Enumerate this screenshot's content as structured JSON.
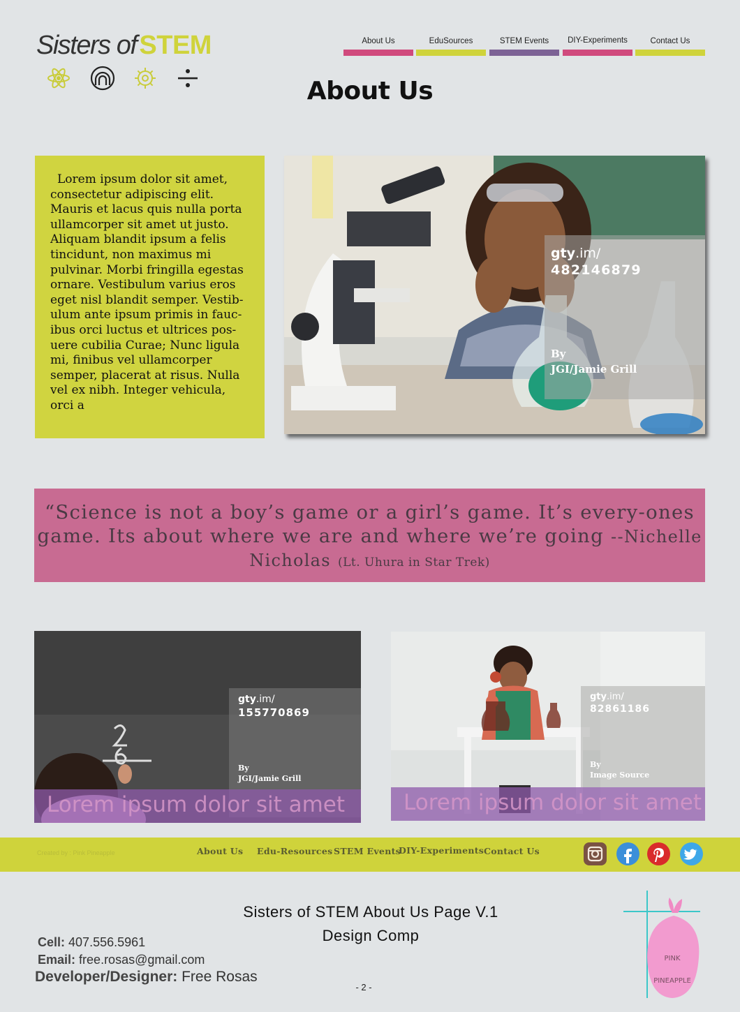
{
  "brand": {
    "name_part1": "Sisters of",
    "name_part2": "STEM"
  },
  "logo_icons": [
    "atom-icon",
    "rainbow-icon",
    "gear-icon",
    "division-icon"
  ],
  "nav": [
    {
      "label": "About Us",
      "color": "#d04a7d"
    },
    {
      "label": "EduSources",
      "color": "#cfd33b"
    },
    {
      "label": "STEM Events",
      "color": "#7c6295"
    },
    {
      "label": "DIY-Experiments",
      "color": "#d04a7d"
    },
    {
      "label": "Contact Us",
      "color": "#cfd33b"
    }
  ],
  "page_title": "About Us",
  "intro": {
    "text": "Lorem ipsum dolor sit amet, consectetur adipiscing elit. Mauris et lacus quis nulla porta ullamcorper sit amet ut justo. Aliquam blandit ipsum a felis tincidunt, non maximus mi pulvinar. Morbi fringilla egestas ornare. Vestibulum varius eros eget nisl blandit semper. Vestib-ulum ante ipsum primis in fauc-ibus orci luctus et ultrices pos-uere cubilia Curae; Nunc ligula mi, finibus vel ullamcorper semper, placerat at risus. Nulla vel ex nibh. Integer vehicula, orci a"
  },
  "main_photo": {
    "gty_bold": "gty",
    "gty_rest": ".im/",
    "id": "482146879",
    "by": "By",
    "author": "JGI/Jamie Grill"
  },
  "quote": {
    "text": "“Science is not a boy’s game or a girl’s game. It’s every-ones game. Its about where we are and where we’re going",
    "author": "--Nichelle Nicholas",
    "note": "(Lt. Uhura in Star Trek)"
  },
  "photo_left": {
    "gty_bold": "gty",
    "gty_rest": ".im/",
    "id": "155770869",
    "by": "By",
    "author": "JGI/Jamie Grill",
    "caption": "Lorem ipsum dolor sit amet"
  },
  "photo_right": {
    "gty_bold": "gty",
    "gty_rest": ".im/",
    "id": "82861186",
    "by": "By",
    "author": "Image Source",
    "caption": "Lorem ipsum dolor sit amet"
  },
  "footer": {
    "created_by": "Created by : Pink Pineapple",
    "links": [
      "About Us",
      "Edu-Resources",
      "STEM Events",
      "DIY-Experiments",
      "Contact Us"
    ],
    "social": [
      {
        "name": "instagram-icon",
        "color": "#7a5243"
      },
      {
        "name": "facebook-icon",
        "color": "#3b8fd9"
      },
      {
        "name": "pinterest-icon",
        "color": "#d92b2b"
      },
      {
        "name": "twitter-icon",
        "color": "#3ea7e8"
      }
    ]
  },
  "comp": {
    "title_line1": "Sisters of STEM About Us Page V.1",
    "title_line2": "Design Comp"
  },
  "contact": {
    "cell_label": "Cell:",
    "cell": "407.556.5961",
    "email_label": "Email:",
    "email": "free.rosas@gmail.com",
    "dev_label": "Developer/Designer:",
    "dev": "Free Rosas"
  },
  "page_number": "- 2 -",
  "pp_logo": {
    "line1": "PINK",
    "line2": "PINEAPPLE"
  }
}
